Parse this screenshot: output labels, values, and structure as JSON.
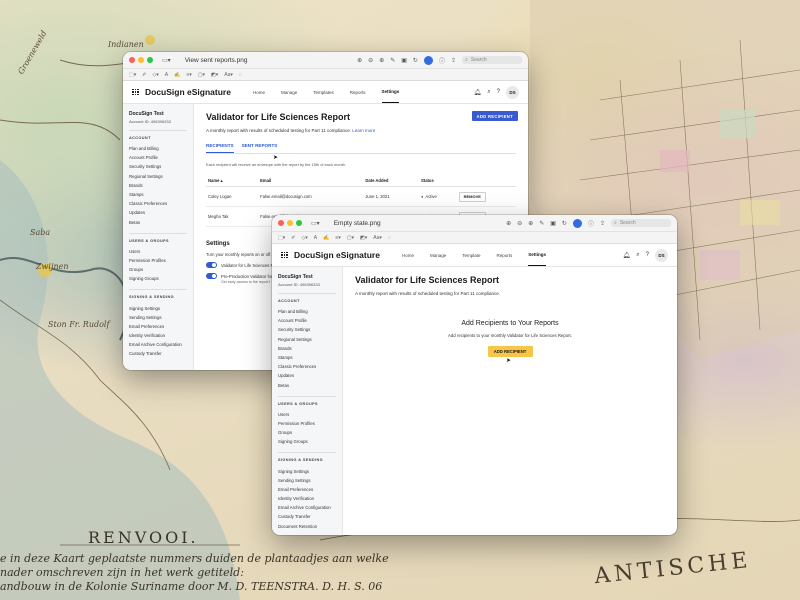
{
  "map": {
    "renvooi": "RENVOOI.",
    "legend_line1": "e in deze Kaart geplaatste nummers duiden de plantaadjes aan welke",
    "legend_line2": "nader omschreven zijn in het werk getiteld:",
    "legend_line3": "andbouw in de Kolonie Suriname door M. D. TEENSTRA. D. H. S. 06",
    "sea_label": "ANTISCHE",
    "labels": [
      "Indianen",
      "Groeneweld",
      "Saba",
      "Zwijnen",
      "Ston Fr. Rudolf"
    ]
  },
  "window1": {
    "title": "View sent reports.png",
    "search_placeholder": "Search",
    "app": {
      "brand": "DocuSign eSignature",
      "nav": [
        "Home",
        "Manage",
        "Templates",
        "Reports",
        "Settings"
      ],
      "avatar": "DS",
      "account_name": "DocuSign Test",
      "account_id": "Account ID: 496396333",
      "sections": [
        {
          "heading": "ACCOUNT",
          "items": [
            "Plan and Billing",
            "Account Profile",
            "Security Settings",
            "Regional Settings",
            "Brands",
            "Stamps",
            "Classic Preferences",
            "Updates",
            "Betas"
          ]
        },
        {
          "heading": "USERS & GROUPS",
          "items": [
            "Users",
            "Permission Profiles",
            "Groups",
            "Signing Groups"
          ]
        },
        {
          "heading": "SIGNING & SENDING",
          "items": [
            "Signing Settings",
            "Sending Settings",
            "Email Preferences",
            "Identity Verification",
            "Email Archive Configuration",
            "Custody Transfer"
          ]
        }
      ],
      "page_title": "Validator for Life Sciences Report",
      "page_desc": "A monthly report with results of scheduled testing for Part 11 compliance.",
      "learn_more": "Learn more",
      "add_recipient": "ADD RECIPIENT",
      "tabs": [
        "RECIPIENTS",
        "SENT REPORTS"
      ],
      "hint": "Each recipient will receive an envelope with the report by the 15th of each month.",
      "table_headers": [
        "Name",
        "Email",
        "Date Added",
        "Status"
      ],
      "rows": [
        {
          "name": "Coley Logan",
          "email": "False.email@docusign.com",
          "date": "June 1, 2021",
          "status": "Active",
          "action": "REMOVE"
        },
        {
          "name": "Megha Tak",
          "email": "False.email@docusign.com",
          "date": "May 23, 2021",
          "status": "Active",
          "action": "REMOVE"
        }
      ],
      "settings_heading": "Settings",
      "settings_sub": "Turn your monthly reports on or off.",
      "toggle1": "Validator for Life Sciences Re",
      "toggle2": "Pre-Production Validator for",
      "toggle_note": "Get early access to the report f"
    }
  },
  "window2": {
    "title": "Empty state.png",
    "search_placeholder": "Search",
    "app": {
      "brand": "DocuSign eSignature",
      "nav": [
        "Home",
        "Manage",
        "Template",
        "Reports",
        "Settings"
      ],
      "avatar": "DS",
      "account_name": "DocuSign Test",
      "account_id": "Account ID: 496396333",
      "sections": [
        {
          "heading": "ACCOUNT",
          "items": [
            "Plan and Billing",
            "Account Profile",
            "Security Settings",
            "Regional Settings",
            "Brands",
            "Stamps",
            "Classic Preferences",
            "Updates",
            "Betas"
          ]
        },
        {
          "heading": "USERS & GROUPS",
          "items": [
            "Users",
            "Permission Profiles",
            "Groups",
            "Signing Groups"
          ]
        },
        {
          "heading": "SIGNING & SENDING",
          "items": [
            "Signing Settings",
            "Sending Settings",
            "Email Preferences",
            "Identity Verification",
            "Email Archive Configuration",
            "Custody Transfer",
            "Document Retention"
          ]
        }
      ],
      "page_title": "Validator for Life Sciences Report",
      "page_desc": "A monthly report with results of scheduled testing for Part 11 compliance.",
      "empty_heading": "Add Recipients to Your Reports",
      "empty_sub": "Add recipients to your monthly Validator for Life Sciences Report.",
      "add_recipient": "ADD RECIPIENT"
    }
  }
}
